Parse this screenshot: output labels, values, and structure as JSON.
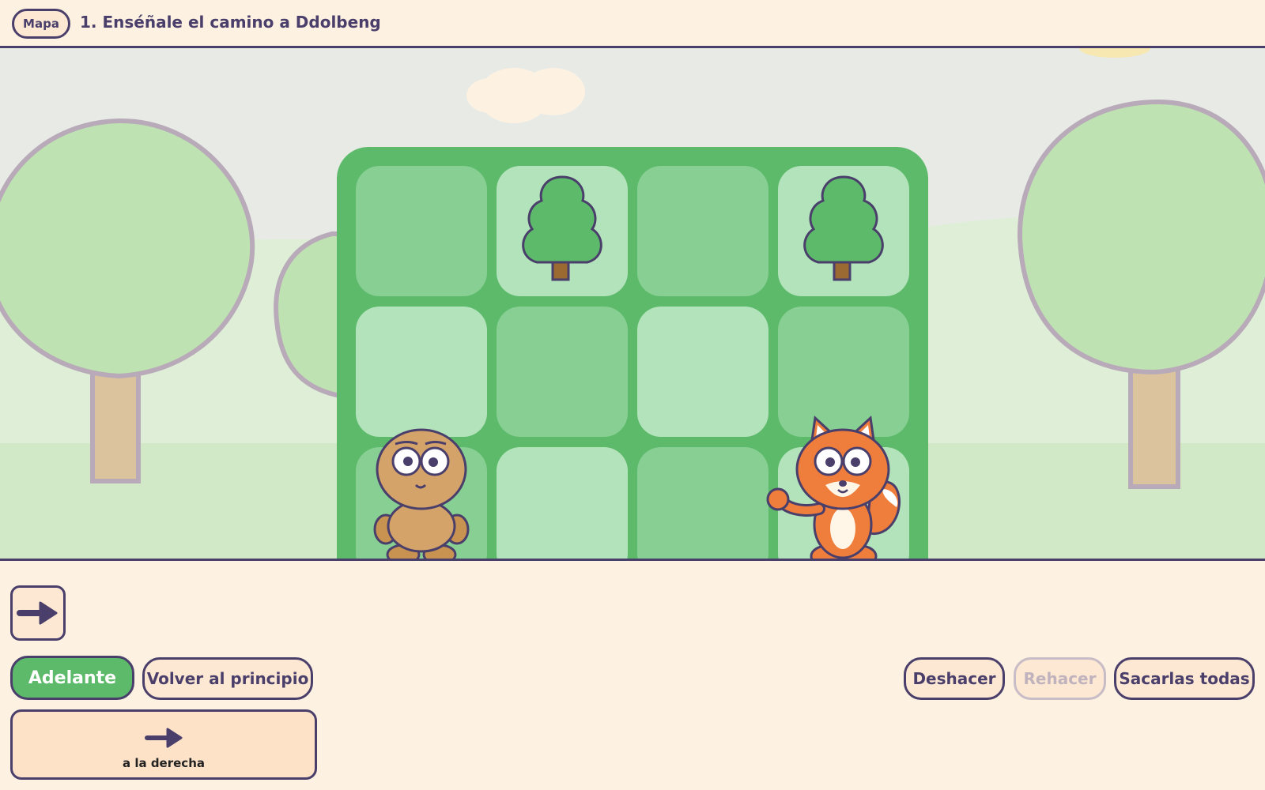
{
  "header": {
    "map_button": "Mapa",
    "level_title": "1. Enséñale el camino a Ddolbeng"
  },
  "board": {
    "rows": 3,
    "cols": 4,
    "cells": [
      [
        "empty",
        "tree",
        "empty",
        "tree"
      ],
      [
        "empty",
        "empty",
        "empty",
        "empty"
      ],
      [
        "character-ddolbeng",
        "empty",
        "empty",
        "goal-fox"
      ]
    ]
  },
  "program": {
    "blocks": [
      "right-arrow-icon"
    ]
  },
  "controls": {
    "run_button": "Adelante",
    "reset_button": "Volver al principio",
    "undo_button": "Deshacer",
    "redo_button": "Rehacer",
    "clear_button": "Sacarlas todas"
  },
  "palette": {
    "blocks": [
      {
        "icon": "right-arrow-icon",
        "label": "a la derecha"
      }
    ]
  },
  "colors": {
    "ink": "#4a3f6b",
    "board": "#5dba6b",
    "cell_light": "#b3e3bb",
    "cell_dark": "#87cf93",
    "background": "#fdf1e1"
  }
}
